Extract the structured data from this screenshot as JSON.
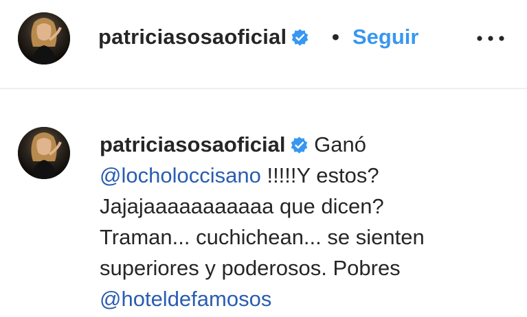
{
  "header": {
    "username": "patriciasosaoficial",
    "separator": "•",
    "follow_label": "Seguir",
    "verified_icon": "verified-badge-icon",
    "more_icon": "more-options-icon"
  },
  "comment": {
    "username": "patriciasosaoficial",
    "line1_text": "Ganó",
    "mention1": "@locholoccisano",
    "line2_text": "!!!!!Y estos?",
    "line3": "Jajajaaaaaaaaaaa que dicen?",
    "line4": "Traman... cuchichean... se sienten",
    "line5": "superiores y poderosos. Pobres",
    "mention2": "@hoteldefamosos"
  },
  "colors": {
    "accent": "#3897f0",
    "mention": "#2a5db0",
    "text": "#262626",
    "divider": "#efefef"
  }
}
